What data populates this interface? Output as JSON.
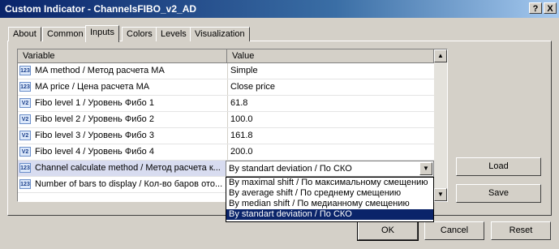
{
  "window": {
    "title": "Custom Indicator - ChannelsFIBO_v2_AD",
    "help_label": "?",
    "close_label": "X"
  },
  "tabs": [
    "About",
    "Common",
    "Inputs",
    "Colors",
    "Levels",
    "Visualization"
  ],
  "active_tab": "Inputs",
  "grid": {
    "headers": {
      "variable": "Variable",
      "value": "Value"
    },
    "rows": [
      {
        "icon": "123",
        "name": "MA method / Метод расчета МА",
        "value": "Simple"
      },
      {
        "icon": "123",
        "name": "MA price / Цена расчета МА",
        "value": "Close price"
      },
      {
        "icon": "V2",
        "name": "Fibo level 1 / Уровень Фибо 1",
        "value": "61.8"
      },
      {
        "icon": "V2",
        "name": "Fibo level 2 / Уровень Фибо 2",
        "value": "100.0"
      },
      {
        "icon": "V2",
        "name": "Fibo level 3 / Уровень Фибо 3",
        "value": "161.8"
      },
      {
        "icon": "V2",
        "name": "Fibo level 4 / Уровень Фибо 4",
        "value": "200.0"
      },
      {
        "icon": "123",
        "name": "Channel calculate method / Метод расчета к...",
        "value": ""
      },
      {
        "icon": "123",
        "name": "Number of bars to display / Кол-во баров ото...",
        "value": ""
      }
    ]
  },
  "combo": {
    "value": "By standart deviation / По СКО",
    "options": [
      "By maximal shift / По максимальному смещению",
      "By average shift / По среднему смещению",
      "By median shift / По медианному смещению",
      "By standart deviation / По СКО"
    ],
    "selected_index": 3
  },
  "buttons": {
    "load": "Load",
    "save": "Save",
    "ok": "OK",
    "cancel": "Cancel",
    "reset": "Reset"
  }
}
